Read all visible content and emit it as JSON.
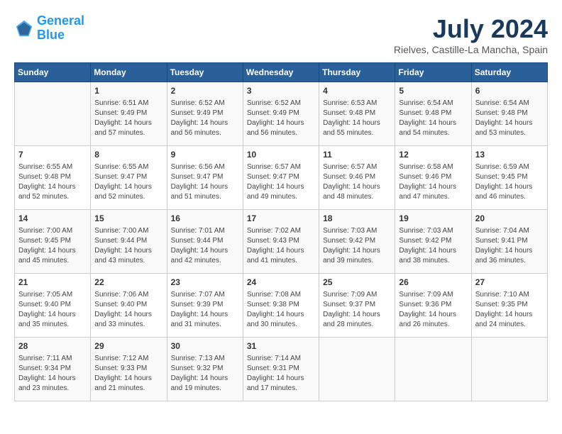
{
  "logo": {
    "line1": "General",
    "line2": "Blue"
  },
  "title": "July 2024",
  "location": "Rielves, Castille-La Mancha, Spain",
  "days_of_week": [
    "Sunday",
    "Monday",
    "Tuesday",
    "Wednesday",
    "Thursday",
    "Friday",
    "Saturday"
  ],
  "weeks": [
    [
      {
        "day": "",
        "info": ""
      },
      {
        "day": "1",
        "info": "Sunrise: 6:51 AM\nSunset: 9:49 PM\nDaylight: 14 hours\nand 57 minutes."
      },
      {
        "day": "2",
        "info": "Sunrise: 6:52 AM\nSunset: 9:49 PM\nDaylight: 14 hours\nand 56 minutes."
      },
      {
        "day": "3",
        "info": "Sunrise: 6:52 AM\nSunset: 9:49 PM\nDaylight: 14 hours\nand 56 minutes."
      },
      {
        "day": "4",
        "info": "Sunrise: 6:53 AM\nSunset: 9:48 PM\nDaylight: 14 hours\nand 55 minutes."
      },
      {
        "day": "5",
        "info": "Sunrise: 6:54 AM\nSunset: 9:48 PM\nDaylight: 14 hours\nand 54 minutes."
      },
      {
        "day": "6",
        "info": "Sunrise: 6:54 AM\nSunset: 9:48 PM\nDaylight: 14 hours\nand 53 minutes."
      }
    ],
    [
      {
        "day": "7",
        "info": "Sunrise: 6:55 AM\nSunset: 9:48 PM\nDaylight: 14 hours\nand 52 minutes."
      },
      {
        "day": "8",
        "info": "Sunrise: 6:55 AM\nSunset: 9:47 PM\nDaylight: 14 hours\nand 52 minutes."
      },
      {
        "day": "9",
        "info": "Sunrise: 6:56 AM\nSunset: 9:47 PM\nDaylight: 14 hours\nand 51 minutes."
      },
      {
        "day": "10",
        "info": "Sunrise: 6:57 AM\nSunset: 9:47 PM\nDaylight: 14 hours\nand 49 minutes."
      },
      {
        "day": "11",
        "info": "Sunrise: 6:57 AM\nSunset: 9:46 PM\nDaylight: 14 hours\nand 48 minutes."
      },
      {
        "day": "12",
        "info": "Sunrise: 6:58 AM\nSunset: 9:46 PM\nDaylight: 14 hours\nand 47 minutes."
      },
      {
        "day": "13",
        "info": "Sunrise: 6:59 AM\nSunset: 9:45 PM\nDaylight: 14 hours\nand 46 minutes."
      }
    ],
    [
      {
        "day": "14",
        "info": "Sunrise: 7:00 AM\nSunset: 9:45 PM\nDaylight: 14 hours\nand 45 minutes."
      },
      {
        "day": "15",
        "info": "Sunrise: 7:00 AM\nSunset: 9:44 PM\nDaylight: 14 hours\nand 43 minutes."
      },
      {
        "day": "16",
        "info": "Sunrise: 7:01 AM\nSunset: 9:44 PM\nDaylight: 14 hours\nand 42 minutes."
      },
      {
        "day": "17",
        "info": "Sunrise: 7:02 AM\nSunset: 9:43 PM\nDaylight: 14 hours\nand 41 minutes."
      },
      {
        "day": "18",
        "info": "Sunrise: 7:03 AM\nSunset: 9:42 PM\nDaylight: 14 hours\nand 39 minutes."
      },
      {
        "day": "19",
        "info": "Sunrise: 7:03 AM\nSunset: 9:42 PM\nDaylight: 14 hours\nand 38 minutes."
      },
      {
        "day": "20",
        "info": "Sunrise: 7:04 AM\nSunset: 9:41 PM\nDaylight: 14 hours\nand 36 minutes."
      }
    ],
    [
      {
        "day": "21",
        "info": "Sunrise: 7:05 AM\nSunset: 9:40 PM\nDaylight: 14 hours\nand 35 minutes."
      },
      {
        "day": "22",
        "info": "Sunrise: 7:06 AM\nSunset: 9:40 PM\nDaylight: 14 hours\nand 33 minutes."
      },
      {
        "day": "23",
        "info": "Sunrise: 7:07 AM\nSunset: 9:39 PM\nDaylight: 14 hours\nand 31 minutes."
      },
      {
        "day": "24",
        "info": "Sunrise: 7:08 AM\nSunset: 9:38 PM\nDaylight: 14 hours\nand 30 minutes."
      },
      {
        "day": "25",
        "info": "Sunrise: 7:09 AM\nSunset: 9:37 PM\nDaylight: 14 hours\nand 28 minutes."
      },
      {
        "day": "26",
        "info": "Sunrise: 7:09 AM\nSunset: 9:36 PM\nDaylight: 14 hours\nand 26 minutes."
      },
      {
        "day": "27",
        "info": "Sunrise: 7:10 AM\nSunset: 9:35 PM\nDaylight: 14 hours\nand 24 minutes."
      }
    ],
    [
      {
        "day": "28",
        "info": "Sunrise: 7:11 AM\nSunset: 9:34 PM\nDaylight: 14 hours\nand 23 minutes."
      },
      {
        "day": "29",
        "info": "Sunrise: 7:12 AM\nSunset: 9:33 PM\nDaylight: 14 hours\nand 21 minutes."
      },
      {
        "day": "30",
        "info": "Sunrise: 7:13 AM\nSunset: 9:32 PM\nDaylight: 14 hours\nand 19 minutes."
      },
      {
        "day": "31",
        "info": "Sunrise: 7:14 AM\nSunset: 9:31 PM\nDaylight: 14 hours\nand 17 minutes."
      },
      {
        "day": "",
        "info": ""
      },
      {
        "day": "",
        "info": ""
      },
      {
        "day": "",
        "info": ""
      }
    ]
  ]
}
